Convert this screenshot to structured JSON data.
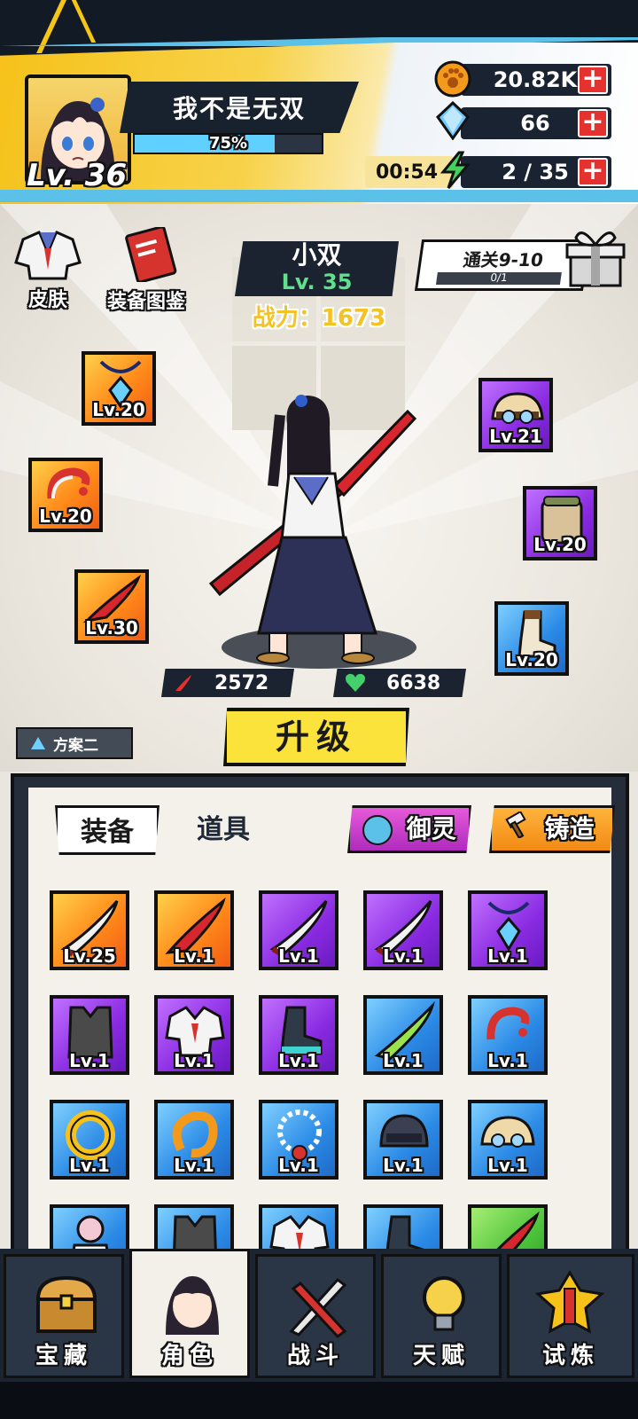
{
  "player": {
    "name": "我不是无双",
    "level": "Lv. 36",
    "exp_text": "75%",
    "exp_fraction": 0.75
  },
  "resources": {
    "coins": {
      "value": "20.82K",
      "icon": "paw-coin-icon"
    },
    "gems": {
      "value": "66",
      "icon": "diamond-icon"
    },
    "energy": {
      "timer": "00:54",
      "value": "2 / 35",
      "icon": "lightning-icon"
    }
  },
  "side_buttons": {
    "skin": "皮肤",
    "codex": "装备图鉴"
  },
  "hero": {
    "name": "小双",
    "level": "Lv. 35",
    "power": "战力：1673"
  },
  "stage": {
    "label": "通关9-10",
    "progress": "0/1",
    "progress_fraction": 0
  },
  "equipped": [
    {
      "name": "necklace",
      "level": "Lv.20"
    },
    {
      "name": "ring",
      "level": "Lv.20"
    },
    {
      "name": "sword",
      "level": "Lv.30"
    },
    {
      "name": "hat",
      "level": "Lv.21"
    },
    {
      "name": "backpack",
      "level": "Lv.20"
    },
    {
      "name": "boots",
      "level": "Lv.20"
    }
  ],
  "stats": {
    "attack": "2572",
    "health": "6638"
  },
  "upgrade_label": "升级",
  "plan_label": "方案二",
  "inventory": {
    "tabs": {
      "equip": "装备",
      "items": "道具"
    },
    "actions": {
      "spirit": "御灵",
      "forge": "铸造"
    },
    "slots": [
      {
        "item": "blade",
        "rarity": "orange",
        "level": "Lv.25"
      },
      {
        "item": "red-sword",
        "rarity": "orange",
        "level": "Lv.1"
      },
      {
        "item": "blade",
        "rarity": "purple",
        "level": "Lv.1"
      },
      {
        "item": "blade",
        "rarity": "purple",
        "level": "Lv.1"
      },
      {
        "item": "necklace",
        "rarity": "purple",
        "level": "Lv.1"
      },
      {
        "item": "vest",
        "rarity": "purple",
        "level": "Lv.1"
      },
      {
        "item": "uniform",
        "rarity": "purple",
        "level": "Lv.1"
      },
      {
        "item": "boots",
        "rarity": "purple",
        "level": "Lv.1"
      },
      {
        "item": "green-blade",
        "rarity": "blue",
        "level": "Lv.1"
      },
      {
        "item": "ring",
        "rarity": "blue",
        "level": "Lv.1"
      },
      {
        "item": "gold-ring",
        "rarity": "blue",
        "level": "Lv.1"
      },
      {
        "item": "dragon-ring",
        "rarity": "blue",
        "level": "Lv.1"
      },
      {
        "item": "bead-necklace",
        "rarity": "blue",
        "level": "Lv.1"
      },
      {
        "item": "helmet",
        "rarity": "blue",
        "level": "Lv.1"
      },
      {
        "item": "hat",
        "rarity": "blue",
        "level": "Lv.1"
      },
      {
        "item": "outfit",
        "rarity": "blue",
        "level": ""
      },
      {
        "item": "vest",
        "rarity": "blue",
        "level": ""
      },
      {
        "item": "uniform",
        "rarity": "blue",
        "level": ""
      },
      {
        "item": "boots",
        "rarity": "blue",
        "level": ""
      },
      {
        "item": "red-sword",
        "rarity": "green",
        "level": ""
      }
    ]
  },
  "nav": [
    {
      "label": "宝藏",
      "icon": "treasure-chest-icon"
    },
    {
      "label": "角色",
      "icon": "character-icon",
      "active": true
    },
    {
      "label": "战斗",
      "icon": "swords-icon"
    },
    {
      "label": "天赋",
      "icon": "lightbulb-icon"
    },
    {
      "label": "试炼",
      "icon": "trial-emblem-icon"
    }
  ],
  "colors": {
    "accent_yellow": "#fbe33b",
    "dark": "#1b2330",
    "orange": "#ff8a1a",
    "purple": "#8a2be2",
    "blue": "#2b8ae6",
    "green": "#4cc23a",
    "red": "#e6322f"
  }
}
